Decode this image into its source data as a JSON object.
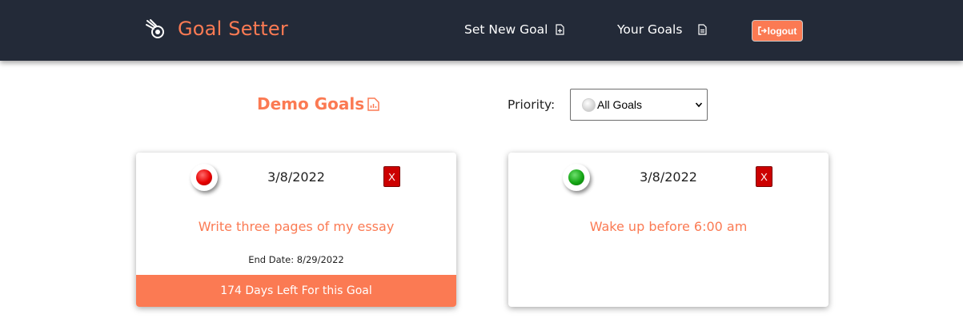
{
  "navbar": {
    "brand": "Goal Setter",
    "links": [
      {
        "label": "Set New Goal",
        "icon": "file-plus-icon"
      },
      {
        "label": "Your Goals",
        "icon": "file-text-icon"
      }
    ],
    "logout_label": "logout",
    "background": "#232a38",
    "accent": "#fb7a53"
  },
  "main": {
    "heading": "Demo Goals",
    "priority_label": "Priority:",
    "priority_selected": "All Goals"
  },
  "goals": [
    {
      "date": "3/8/2022",
      "priority": "red",
      "delete_label": "X",
      "text": "Write three pages of my essay",
      "end_date": "End Date: 8/29/2022",
      "days_left": "174 Days Left For this Goal"
    },
    {
      "date": "3/8/2022",
      "priority": "green",
      "delete_label": "X",
      "text": "Wake up before 6:00 am"
    }
  ]
}
